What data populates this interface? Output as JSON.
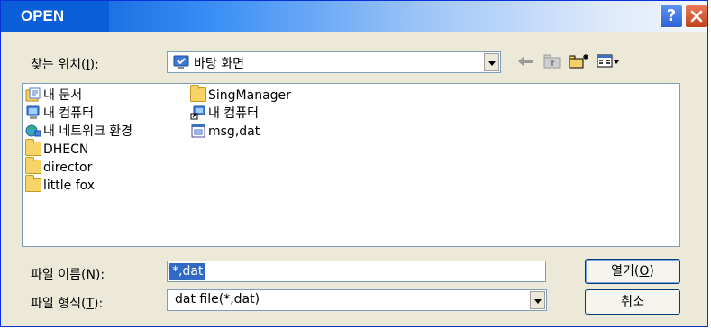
{
  "window": {
    "title": "OPEN"
  },
  "titlebar_buttons": {
    "help": "?",
    "close_icon": "close-x-icon"
  },
  "look_in": {
    "label_pre": "찾는 위치(",
    "label_key": "I",
    "label_post": "):",
    "value": "바탕 화면",
    "icon": "desktop-icon"
  },
  "toolbar": {
    "icons": [
      "back-arrow-icon",
      "up-folder-icon",
      "new-folder-icon",
      "view-menu-icon"
    ]
  },
  "file_list": {
    "columns": [
      [
        {
          "name": "내 문서",
          "icon": "my-documents-icon"
        },
        {
          "name": "내 컴퓨터",
          "icon": "my-computer-icon"
        },
        {
          "name": "내 네트워크 환경",
          "icon": "network-icon"
        },
        {
          "name": "DHECN",
          "icon": "folder-icon"
        },
        {
          "name": "director",
          "icon": "folder-icon"
        },
        {
          "name": "little fox",
          "icon": "folder-icon"
        }
      ],
      [
        {
          "name": "SingManager",
          "icon": "folder-icon"
        },
        {
          "name": "내 컴퓨터",
          "icon": "computer-shortcut-icon"
        },
        {
          "name": "msg,dat",
          "icon": "dat-file-icon"
        }
      ]
    ]
  },
  "filename": {
    "label_pre": "파일 이름(",
    "label_key": "N",
    "label_post": "):",
    "value": "*,dat"
  },
  "filetype": {
    "label_pre": "파일 형식(",
    "label_key": "T",
    "label_post": "):",
    "value": "dat file(*,dat)"
  },
  "buttons": {
    "open_pre": "열기(",
    "open_key": "O",
    "open_post": ")",
    "cancel": "취소"
  }
}
